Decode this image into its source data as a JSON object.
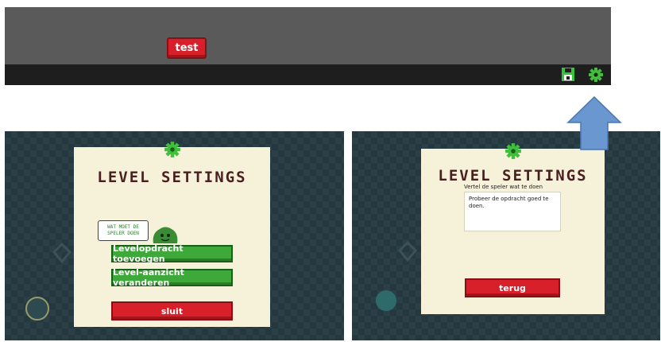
{
  "toolbar": {
    "test_button_label": "test",
    "save_icon": "save-icon",
    "settings_icon": "gear-icon"
  },
  "left_dialog": {
    "title": "LEVEL SETTINGS",
    "speech_bubble": "WAT MOET DE SPELER DOEN",
    "add_instruction_button": "Levelopdracht toevoegen",
    "change_view_button": "Level-aanzicht veranderen",
    "close_button": "sluit"
  },
  "right_dialog": {
    "title": "LEVEL SETTINGS",
    "instruction_label": "Vertel de speler wat te doen",
    "instruction_value": "Probeer de opdracht goed te doen.",
    "back_button": "terug"
  },
  "colors": {
    "toolbar": "#5a5a5a",
    "bottombar": "#1e1e1e",
    "red_button": "#d8202a",
    "green_button": "#3ea83a",
    "card": "#f6f1d9",
    "title": "#4a1f1f",
    "game_bg": "#243840",
    "arrow": "#6a97cf"
  }
}
